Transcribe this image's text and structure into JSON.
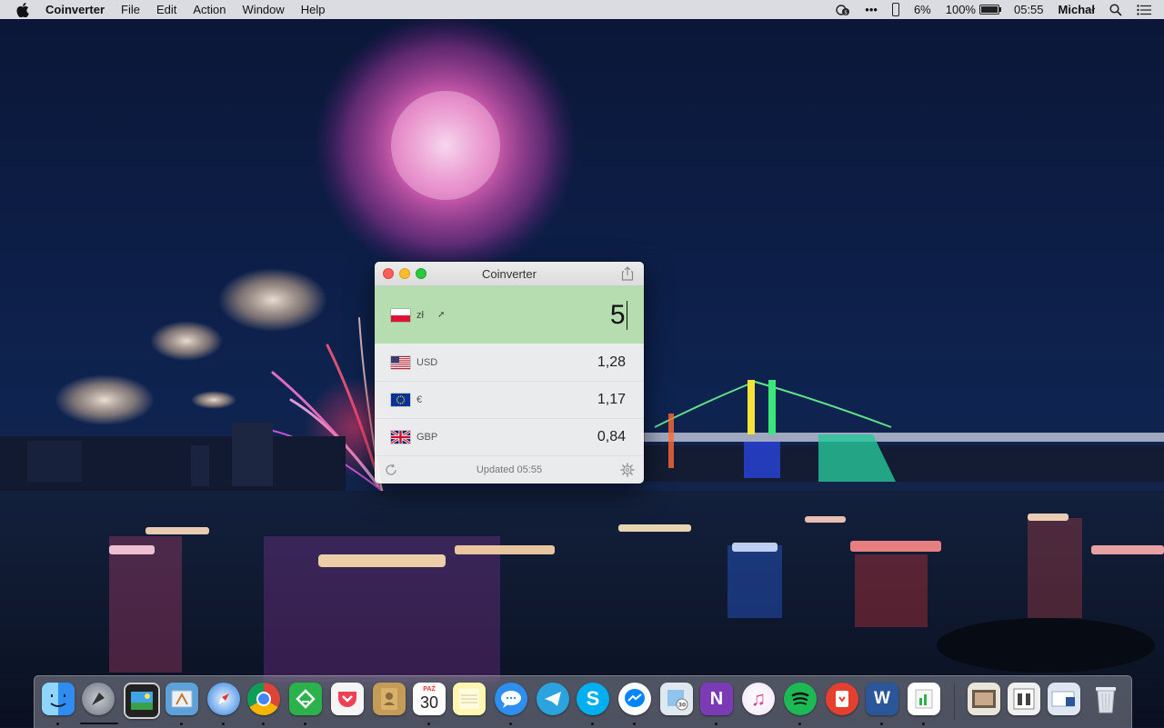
{
  "menubar": {
    "app_name": "Coinverter",
    "menus": [
      "File",
      "Edit",
      "Action",
      "Window",
      "Help"
    ],
    "status": {
      "percent_small": "6%",
      "battery_percent": "100%",
      "time": "05:55",
      "user": "Michał"
    }
  },
  "window": {
    "title": "Coinverter",
    "base": {
      "flag": "poland-flag",
      "label": "zł",
      "pin_glyph": "➚",
      "value": "5"
    },
    "conversions": [
      {
        "flag": "usa-flag",
        "label": "USD",
        "value": "1,28"
      },
      {
        "flag": "eu-flag",
        "label": "€",
        "value": "1,17"
      },
      {
        "flag": "uk-flag",
        "label": "GBP",
        "value": "0,84"
      }
    ],
    "footer": {
      "updated": "Updated 05:55"
    }
  },
  "dock": {
    "calendar": {
      "month": "PAŹ",
      "day": "30"
    },
    "apps": [
      "finder",
      "launchpad",
      "image-capture",
      "mail",
      "safari",
      "chrome",
      "feedly",
      "pocket",
      "contacts",
      "calendar",
      "notes",
      "messages",
      "telegram",
      "skype",
      "messenger",
      "preview",
      "onenote",
      "itunes",
      "spotify",
      "pdf-expert",
      "word",
      "numbers",
      "downloads-folder",
      "screenshot-folder",
      "documents-folder",
      "trash"
    ]
  },
  "colors": {
    "input_row_bg": "#b5ddb0",
    "close": "#fc5f57",
    "minimize": "#fdbc2e",
    "maximize": "#28c840"
  }
}
